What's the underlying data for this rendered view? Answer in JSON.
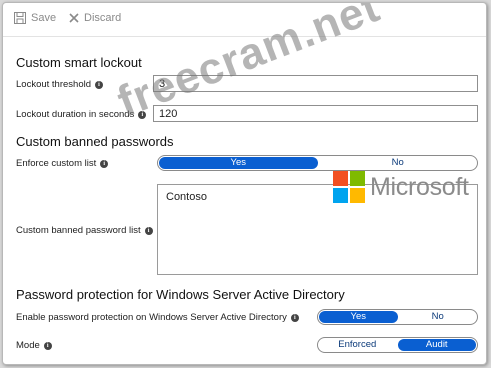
{
  "toolbar": {
    "save_label": "Save",
    "discard_label": "Discard"
  },
  "smart_lockout": {
    "heading": "Custom smart lockout",
    "threshold_label": "Lockout threshold",
    "threshold_value": "3",
    "duration_label": "Lockout duration in seconds",
    "duration_value": "120"
  },
  "banned_passwords": {
    "heading": "Custom banned passwords",
    "enforce_label": "Enforce custom list",
    "enforce_options": [
      "Yes",
      "No"
    ],
    "enforce_selected": "Yes",
    "list_label": "Custom banned password list",
    "list_value": "Contoso"
  },
  "ad_protection": {
    "heading": "Password protection for Windows Server Active Directory",
    "enable_label": "Enable password protection on Windows Server Active Directory",
    "enable_options": [
      "Yes",
      "No"
    ],
    "enable_selected": "Yes",
    "mode_label": "Mode",
    "mode_options": [
      "Enforced",
      "Audit"
    ],
    "mode_selected": "Audit"
  },
  "overlay": {
    "watermark": "freecram.net",
    "brand": "Microsoft"
  },
  "colors": {
    "toggle_on": "#0a5fd1",
    "ms_red": "#f25022",
    "ms_green": "#7fba00",
    "ms_blue": "#00a4ef",
    "ms_yellow": "#ffb900"
  }
}
